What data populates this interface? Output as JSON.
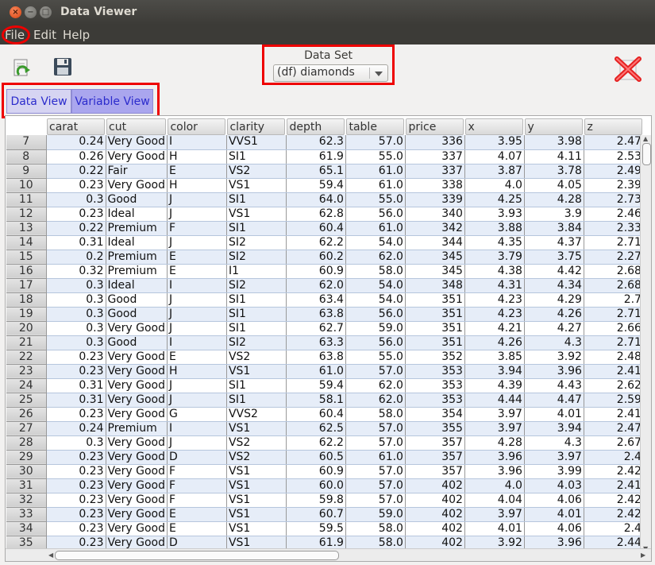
{
  "window": {
    "title": "Data Viewer"
  },
  "menu": {
    "items": [
      "File",
      "Edit",
      "Help"
    ]
  },
  "dataset": {
    "label": "Data Set",
    "selected": "(df) diamonds"
  },
  "tabs": [
    "Data View",
    "Variable View"
  ],
  "grid": {
    "columns": [
      "carat",
      "cut",
      "color",
      "clarity",
      "depth",
      "table",
      "price",
      "x",
      "y",
      "z"
    ],
    "rows": [
      [
        "7",
        "0.24",
        "Very Good",
        "I",
        "VVS1",
        "62.3",
        "57.0",
        "336",
        "3.95",
        "3.98",
        "2.47"
      ],
      [
        "8",
        "0.26",
        "Very Good",
        "H",
        "SI1",
        "61.9",
        "55.0",
        "337",
        "4.07",
        "4.11",
        "2.53"
      ],
      [
        "9",
        "0.22",
        "Fair",
        "E",
        "VS2",
        "65.1",
        "61.0",
        "337",
        "3.87",
        "3.78",
        "2.49"
      ],
      [
        "10",
        "0.23",
        "Very Good",
        "H",
        "VS1",
        "59.4",
        "61.0",
        "338",
        "4.0",
        "4.05",
        "2.39"
      ],
      [
        "11",
        "0.3",
        "Good",
        "J",
        "SI1",
        "64.0",
        "55.0",
        "339",
        "4.25",
        "4.28",
        "2.73"
      ],
      [
        "12",
        "0.23",
        "Ideal",
        "J",
        "VS1",
        "62.8",
        "56.0",
        "340",
        "3.93",
        "3.9",
        "2.46"
      ],
      [
        "13",
        "0.22",
        "Premium",
        "F",
        "SI1",
        "60.4",
        "61.0",
        "342",
        "3.88",
        "3.84",
        "2.33"
      ],
      [
        "14",
        "0.31",
        "Ideal",
        "J",
        "SI2",
        "62.2",
        "54.0",
        "344",
        "4.35",
        "4.37",
        "2.71"
      ],
      [
        "15",
        "0.2",
        "Premium",
        "E",
        "SI2",
        "60.2",
        "62.0",
        "345",
        "3.79",
        "3.75",
        "2.27"
      ],
      [
        "16",
        "0.32",
        "Premium",
        "E",
        "I1",
        "60.9",
        "58.0",
        "345",
        "4.38",
        "4.42",
        "2.68"
      ],
      [
        "17",
        "0.3",
        "Ideal",
        "I",
        "SI2",
        "62.0",
        "54.0",
        "348",
        "4.31",
        "4.34",
        "2.68"
      ],
      [
        "18",
        "0.3",
        "Good",
        "J",
        "SI1",
        "63.4",
        "54.0",
        "351",
        "4.23",
        "4.29",
        "2.7"
      ],
      [
        "19",
        "0.3",
        "Good",
        "J",
        "SI1",
        "63.8",
        "56.0",
        "351",
        "4.23",
        "4.26",
        "2.71"
      ],
      [
        "20",
        "0.3",
        "Very Good",
        "J",
        "SI1",
        "62.7",
        "59.0",
        "351",
        "4.21",
        "4.27",
        "2.66"
      ],
      [
        "21",
        "0.3",
        "Good",
        "I",
        "SI2",
        "63.3",
        "56.0",
        "351",
        "4.26",
        "4.3",
        "2.71"
      ],
      [
        "22",
        "0.23",
        "Very Good",
        "E",
        "VS2",
        "63.8",
        "55.0",
        "352",
        "3.85",
        "3.92",
        "2.48"
      ],
      [
        "23",
        "0.23",
        "Very Good",
        "H",
        "VS1",
        "61.0",
        "57.0",
        "353",
        "3.94",
        "3.96",
        "2.41"
      ],
      [
        "24",
        "0.31",
        "Very Good",
        "J",
        "SI1",
        "59.4",
        "62.0",
        "353",
        "4.39",
        "4.43",
        "2.62"
      ],
      [
        "25",
        "0.31",
        "Very Good",
        "J",
        "SI1",
        "58.1",
        "62.0",
        "353",
        "4.44",
        "4.47",
        "2.59"
      ],
      [
        "26",
        "0.23",
        "Very Good",
        "G",
        "VVS2",
        "60.4",
        "58.0",
        "354",
        "3.97",
        "4.01",
        "2.41"
      ],
      [
        "27",
        "0.24",
        "Premium",
        "I",
        "VS1",
        "62.5",
        "57.0",
        "355",
        "3.97",
        "3.94",
        "2.47"
      ],
      [
        "28",
        "0.3",
        "Very Good",
        "J",
        "VS2",
        "62.2",
        "57.0",
        "357",
        "4.28",
        "4.3",
        "2.67"
      ],
      [
        "29",
        "0.23",
        "Very Good",
        "D",
        "VS2",
        "60.5",
        "61.0",
        "357",
        "3.96",
        "3.97",
        "2.4"
      ],
      [
        "30",
        "0.23",
        "Very Good",
        "F",
        "VS1",
        "60.9",
        "57.0",
        "357",
        "3.96",
        "3.99",
        "2.42"
      ],
      [
        "31",
        "0.23",
        "Very Good",
        "F",
        "VS1",
        "60.0",
        "57.0",
        "402",
        "4.0",
        "4.03",
        "2.41"
      ],
      [
        "32",
        "0.23",
        "Very Good",
        "F",
        "VS1",
        "59.8",
        "57.0",
        "402",
        "4.04",
        "4.06",
        "2.42"
      ],
      [
        "33",
        "0.23",
        "Very Good",
        "E",
        "VS1",
        "60.7",
        "59.0",
        "402",
        "3.97",
        "4.01",
        "2.42"
      ],
      [
        "34",
        "0.23",
        "Very Good",
        "E",
        "VS1",
        "59.5",
        "58.0",
        "402",
        "4.01",
        "4.06",
        "2.4"
      ],
      [
        "35",
        "0.23",
        "Very Good",
        "D",
        "VS1",
        "61.9",
        "58.0",
        "402",
        "3.92",
        "3.96",
        "2.44"
      ]
    ]
  }
}
